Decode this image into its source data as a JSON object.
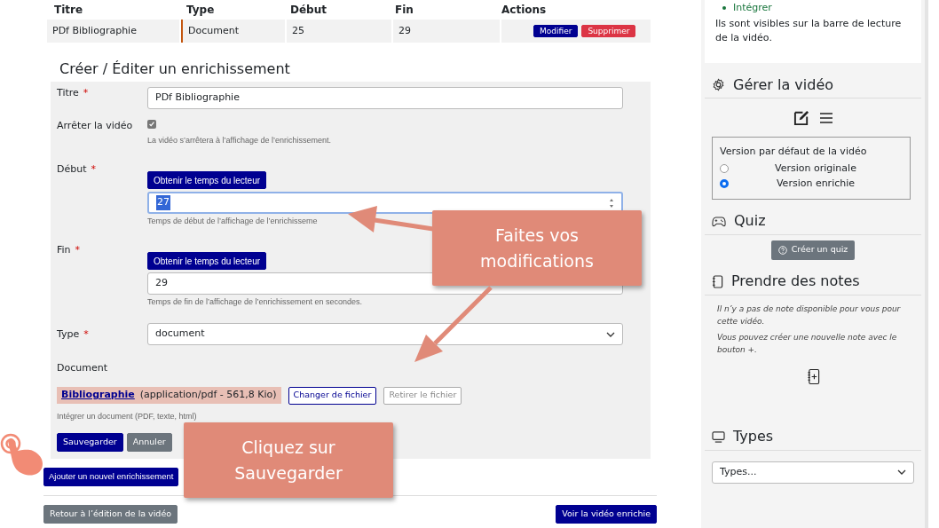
{
  "table": {
    "columns": [
      "Titre",
      "Type",
      "Début",
      "Fin",
      "Actions"
    ],
    "rows": [
      {
        "cells": [
          "PDf Bibliographie",
          "Document",
          "25",
          "29"
        ],
        "actions": [
          {
            "label": "Modifier",
            "kind": "primary"
          },
          {
            "label": "Supprimer",
            "kind": "danger"
          }
        ]
      }
    ]
  },
  "form": {
    "title": "Créer / Éditer un enrichissement",
    "fields": [
      {
        "kind": "text",
        "label": "Titre",
        "required_mark": "*",
        "value": "PDf Bibliographie"
      },
      {
        "kind": "checkbox",
        "label": "Arrêter la vidéo",
        "checked": true,
        "help": "La vidéo s’arrêtera à l’affichage de l’enrichissement."
      },
      {
        "kind": "number",
        "label": "Début",
        "required_mark": "*",
        "button": "Obtenir le temps du lecteur",
        "value": "27",
        "focused": true,
        "help": "Temps de début de l’affichage de l’enrichisseme"
      },
      {
        "kind": "number",
        "label": "Fin",
        "required_mark": "*",
        "button": "Obtenir le temps du lecteur",
        "value": "29",
        "focused": false,
        "help": "Temps de fin de l’affichage de l’enrichissement en secondes."
      },
      {
        "kind": "select",
        "label": "Type",
        "required_mark": "*",
        "value": "document"
      },
      {
        "kind": "file",
        "label": "Document",
        "file_link": "Bibliographie",
        "file_info": "(application/pdf - 561,8 Kio)",
        "change": "Changer de fichier",
        "remove": "Retirer le fichier",
        "help": "Intégrer un document (PDF, texte, html)"
      }
    ],
    "buttons": [
      {
        "label": "Sauvegarder",
        "kind": "primary"
      },
      {
        "label": "Annuler",
        "kind": "secondary"
      }
    ]
  },
  "add_button": "Ajouter un nouvel enrichissement",
  "footer": {
    "back": "Retour à l’édition de la vidéo",
    "view": "Voir la vidéo enrichie"
  },
  "sidebar": {
    "partial_item": "Intégrer",
    "info": "Ils sont visibles sur la barre de lecture de la vidéo.",
    "manage": {
      "title": "Gérer la vidéo",
      "legend": "Version par défaut de la vidéo",
      "options": [
        {
          "label": "Version originale",
          "selected": false
        },
        {
          "label": "Version enrichie",
          "selected": true
        }
      ]
    },
    "quiz": {
      "title": "Quiz",
      "button": "Créer un quiz"
    },
    "notes": {
      "title": "Prendre des notes",
      "lines": [
        "Il n’y a pas de note disponible pour vous pour cette vidéo.",
        "Vous pouvez créer une nouvelle note avec le bouton +."
      ]
    },
    "types": {
      "title": "Types",
      "placeholder": "Types..."
    }
  },
  "callouts": [
    {
      "text": "Faites vos modifications"
    },
    {
      "text": "Cliquez sur Sauvegarder"
    }
  ]
}
